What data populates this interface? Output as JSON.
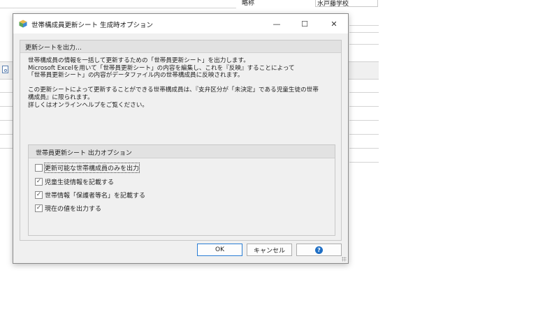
{
  "background": {
    "field_label": "略称",
    "field_value": "水戸藤学校"
  },
  "dialog": {
    "title": "世帯構成員更新シート 生成時オプション",
    "window_controls": {
      "minimize": "—",
      "maximize": "☐",
      "close": "✕"
    },
    "section_header": "更新シートを出力…",
    "description": {
      "line1": "世帯構成員の情報を一括して更新するための「世帯員更新シート」を出力します。",
      "line2": "Microsoft Excelを用いて「世帯員更新シート」の内容を編集し、これを『反映』することによって",
      "line3": "「世帯員更新シート」の内容がデータファイル内の世帯構成員に反映されます。",
      "line4": "この更新シートによって更新することができる世帯構成員は、『支弁区分が「未決定」である児童生徒の世帯",
      "line5": "構成員』に限られます。",
      "line6": "詳しくはオンラインヘルプをご覧ください。"
    },
    "options_header": "世帯員更新シート 出力オプション",
    "options": [
      {
        "label": "更新可能な世帯構成員のみを出力",
        "checked": false
      },
      {
        "label": "児童生徒情報を記載する",
        "checked": true
      },
      {
        "label": "世帯情報「保護者等名」を記載する",
        "checked": true
      },
      {
        "label": "現在の値を出力する",
        "checked": true
      }
    ],
    "check_mark": "✓",
    "buttons": {
      "ok": "OK",
      "cancel": "キャンセル",
      "help": "?"
    }
  }
}
